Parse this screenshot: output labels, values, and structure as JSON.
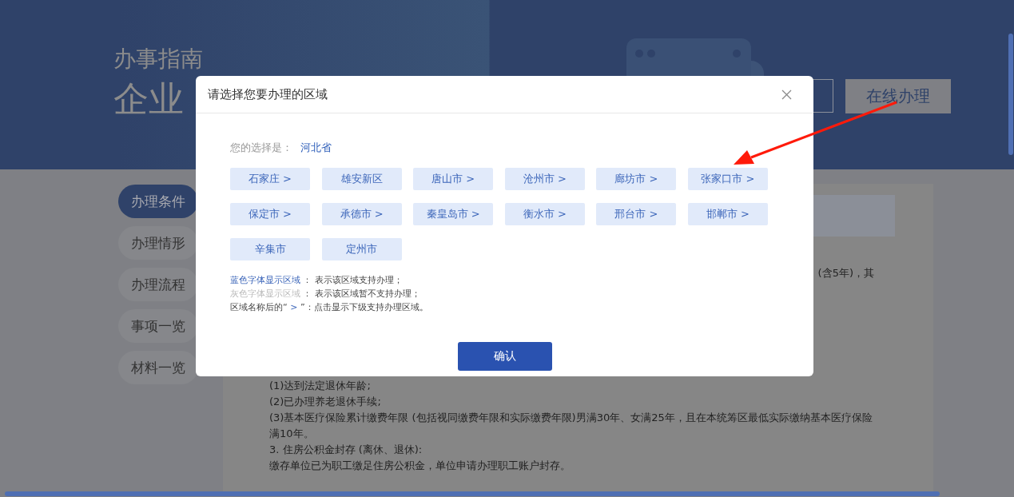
{
  "page": {
    "guide_label": "办事指南",
    "title": "企业",
    "online_button": "在线办理"
  },
  "nav": [
    {
      "label": "办理条件",
      "selected": true
    },
    {
      "label": "办理情形",
      "selected": false
    },
    {
      "label": "办理流程",
      "selected": false
    },
    {
      "label": "事项一览",
      "selected": false
    },
    {
      "label": "材料一览",
      "selected": false
    }
  ],
  "content": {
    "partial_line": "(含5年)，其",
    "lines": [
      "(1)达到法定退休年龄;",
      "(2)已办理养老退休手续;",
      "(3)基本医疗保险累计缴费年限 (包括视同缴费年限和实际缴费年限)男满30年、女满25年，且在本统筹区最低实际缴纳基本医疗保险满10年。",
      "3. 住房公积金封存 (离休、退休):",
      "缴存单位已为职工缴足住房公积金，单位申请办理职工账户封存。"
    ]
  },
  "dialog": {
    "title": "请选择您要办理的区域",
    "selection_label": "您的选择是：",
    "selection_value": "河北省",
    "regions": [
      {
        "label": "石家庄 >",
        "supported": true
      },
      {
        "label": "雄安新区",
        "supported": true
      },
      {
        "label": "唐山市 >",
        "supported": true
      },
      {
        "label": "沧州市 >",
        "supported": true
      },
      {
        "label": "廊坊市 >",
        "supported": true
      },
      {
        "label": "张家口市 >",
        "supported": true
      },
      {
        "label": "保定市 >",
        "supported": true
      },
      {
        "label": "承德市 >",
        "supported": true
      },
      {
        "label": "秦皇岛市 >",
        "supported": true
      },
      {
        "label": "衡水市 >",
        "supported": true
      },
      {
        "label": "邢台市 >",
        "supported": true
      },
      {
        "label": "邯郸市 >",
        "supported": true
      },
      {
        "label": "辛集市",
        "supported": true
      },
      {
        "label": "定州市",
        "supported": true
      }
    ],
    "legend": [
      [
        {
          "text": "蓝色字体显示区域",
          "kind": "blue"
        },
        {
          "text": " ： 表示该区域支持办理；",
          "kind": "plain"
        }
      ],
      [
        {
          "text": "灰色字体显示区域",
          "kind": "grey"
        },
        {
          "text": " ： 表示该区域暂不支持办理；",
          "kind": "plain"
        }
      ],
      [
        {
          "text": "区域名称后的“ ",
          "kind": "plain"
        },
        {
          "text": ">",
          "kind": "blue"
        },
        {
          "text": " ”：点击显示下级支持办理区域。",
          "kind": "plain"
        }
      ]
    ],
    "confirm": "确认"
  }
}
